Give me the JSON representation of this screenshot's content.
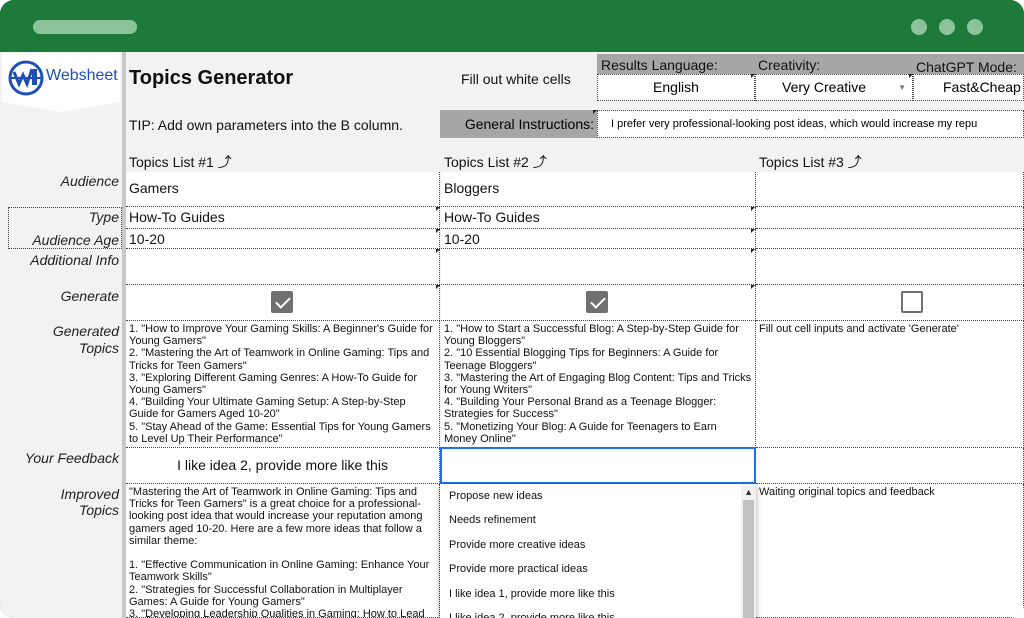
{
  "app": {
    "logo_text": "Websheet",
    "title": "Topics Generator"
  },
  "toolbar": {
    "fill_hint": "Fill out white cells",
    "results_language_label": "Results Language:",
    "results_language_value": "English",
    "creativity_label": "Creativity:",
    "creativity_value": "Very Creative",
    "chatgpt_mode_label": "ChatGPT Mode:",
    "chatgpt_mode_value": "Fast&Cheap",
    "tip": "TIP: Add own parameters into the B column.",
    "general_instructions_label": "General Instructions:",
    "general_instructions_value": "I prefer very professional-looking post ideas, which would increase my repu"
  },
  "row_labels": {
    "audience": "Audience",
    "type": "Type",
    "audience_age": "Audience Age",
    "additional_info": "Additional Info",
    "generate": "Generate",
    "generated_topics_1": "Generated",
    "generated_topics_2": "Topics",
    "your_feedback": "Your Feedback",
    "improved_topics_1": "Improved",
    "improved_topics_2": "Topics"
  },
  "columns": [
    {
      "header": "Topics List #1 ⤴",
      "audience": "Gamers",
      "type": "How-To Guides",
      "audience_age": "10-20",
      "additional_info": "",
      "generated": "1. \"How to Improve Your Gaming Skills: A Beginner's Guide for Young Gamers\"\n2. \"Mastering the Art of Teamwork in Online Gaming: Tips and Tricks for Teen Gamers\"\n3. \"Exploring Different Gaming Genres: A How-To Guide for Young Gamers\"\n4. \"Building Your Ultimate Gaming Setup: A Step-by-Step Guide for Gamers Aged 10-20\"\n5. \"Stay Ahead of the Game: Essential Tips for Young Gamers to Level Up Their Performance\"",
      "feedback": "I like idea 2, provide more like this",
      "improved": "\"Mastering the Art of Teamwork in Online Gaming: Tips and Tricks for Teen Gamers\" is a great choice for a professional-looking post idea that would increase your reputation among gamers aged 10-20. Here are a few more ideas that follow a similar theme:\n\n1. \"Effective Communication in Online Gaming: Enhance Your Teamwork Skills\"\n2. \"Strategies for Successful Collaboration in Multiplayer Games: A Guide for Young Gamers\"\n3. \"Developing Leadership Qualities in Gaming: How to Lead"
    },
    {
      "header": "Topics List #2 ⤴",
      "audience": "Bloggers",
      "type": "How-To Guides",
      "audience_age": "10-20",
      "additional_info": "",
      "generated": "1. \"How to Start a Successful Blog: A Step-by-Step Guide for Young Bloggers\"\n2. \"10 Essential Blogging Tips for Beginners: A Guide for Teenage Bloggers\"\n3. \"Mastering the Art of Engaging Blog Content: Tips and Tricks for Young Writers\"\n4. \"Building Your Personal Brand as a Teenage Blogger: Strategies for Success\"\n5. \"Monetizing Your Blog: A Guide for Teenagers to Earn Money Online\"",
      "feedback": "",
      "improved": ""
    },
    {
      "header": "Topics List #3 ⤴",
      "audience": "",
      "type": "",
      "audience_age": "",
      "additional_info": "",
      "generated": "Fill out cell inputs and activate 'Generate'",
      "feedback": "",
      "improved": "Waiting original topics and feedback"
    }
  ],
  "generate_checked": [
    true,
    true,
    false
  ],
  "dropdown": {
    "items": [
      "Propose new ideas",
      "Needs refinement",
      "Provide more creative ideas",
      "Provide more practical ideas",
      "I like idea 1, provide more like this",
      "I like idea 2, provide more like this"
    ]
  },
  "colors": {
    "titlebar": "#1d7a3b",
    "accent_border": "#1a73e8",
    "grey_header": "#a6a6a6"
  }
}
